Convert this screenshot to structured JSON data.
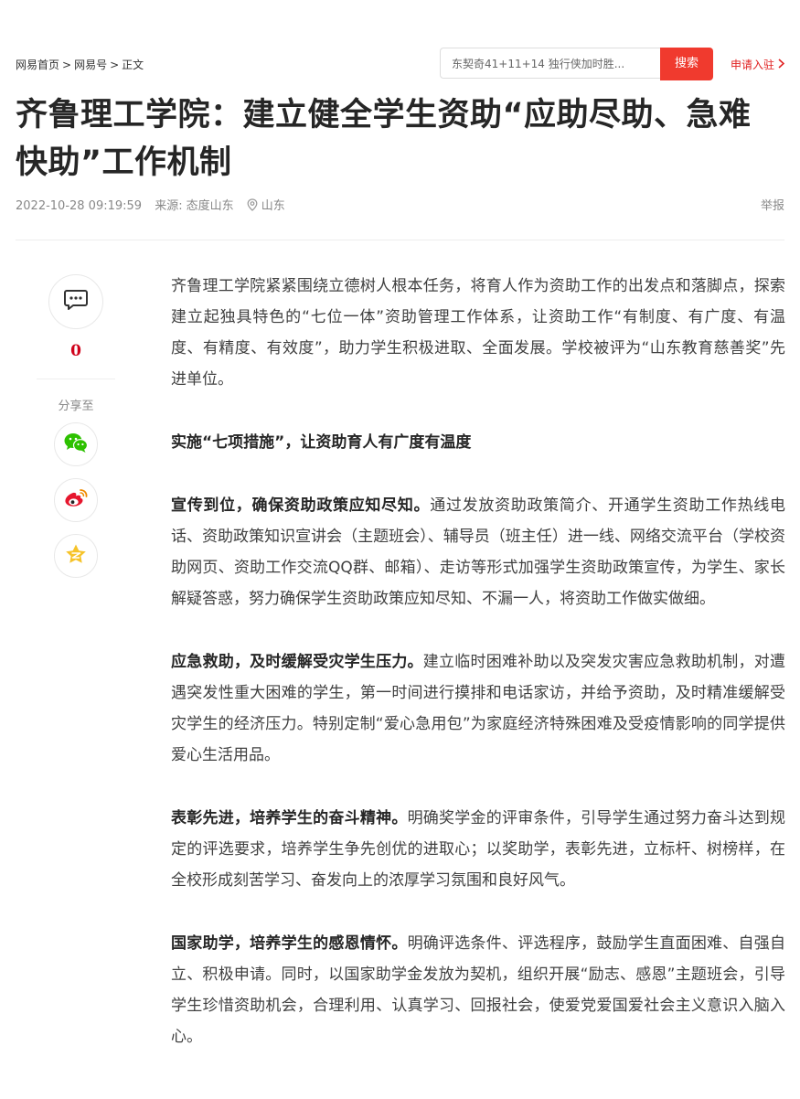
{
  "breadcrumb": {
    "home": "网易首页",
    "sep1": ">",
    "section": "网易号",
    "sep2": ">",
    "current": "正文"
  },
  "search": {
    "value": "东契奇41+11+14 独行侠加时胜...",
    "button": "搜索"
  },
  "apply": {
    "label": "申请入驻"
  },
  "article": {
    "title": "齐鲁理工学院：建立健全学生资助“应助尽助、急难快助”工作机制",
    "date": "2022-10-28 09:19:59",
    "source_prefix": "来源:",
    "source": "态度山东",
    "location": "山东",
    "report": "举报"
  },
  "sidebar": {
    "comment_count": "0",
    "share_label": "分享至"
  },
  "icons": {
    "comment": "comment-bubble-icon",
    "wechat": "wechat-icon",
    "weibo": "weibo-icon",
    "qzone": "qzone-star-icon",
    "location": "location-pin-icon",
    "chevron": "chevron-right-icon"
  },
  "colors": {
    "brand_red": "#f03a2e",
    "accent_red": "#e02020",
    "wechat_green": "#2dc100",
    "qzone_yellow": "#f6c32a"
  },
  "content": {
    "intro": "齐鲁理工学院紧紧围绕立德树人根本任务，将育人作为资助工作的出发点和落脚点，探索建立起独具特色的“七位一体”资助管理工作体系，让资助工作“有制度、有广度、有温度、有精度、有效度”，助力学生积极进取、全面发展。学校被评为“山东教育慈善奖”先进单位。",
    "heading": "实施“七项措施”，让资助育人有广度有温度",
    "p1_bold": "宣传到位，确保资助政策应知尽知。",
    "p1_text": "通过发放资助政策简介、开通学生资助工作热线电话、资助政策知识宣讲会（主题班会）、辅导员（班主任）进一线、网络交流平台（学校资助网页、资助工作交流QQ群、邮箱）、走访等形式加强学生资助政策宣传，为学生、家长解疑答惑，努力确保学生资助政策应知尽知、不漏一人，将资助工作做实做细。",
    "p2_bold": "应急救助，及时缓解受灾学生压力。",
    "p2_text": "建立临时困难补助以及突发灾害应急救助机制，对遭遇突发性重大困难的学生，第一时间进行摸排和电话家访，并给予资助，及时精准缓解受灾学生的经济压力。特别定制“爱心急用包”为家庭经济特殊困难及受疫情影响的同学提供爱心生活用品。",
    "p3_bold": "表彰先进，培养学生的奋斗精神。",
    "p3_text": "明确奖学金的评审条件，引导学生通过努力奋斗达到规定的评选要求，培养学生争先创优的进取心；以奖助学，表彰先进，立标杆、树榜样，在全校形成刻苦学习、奋发向上的浓厚学习氛围和良好风气。",
    "p4_bold": "国家助学，培养学生的感恩情怀。",
    "p4_text": "明确评选条件、评选程序，鼓励学生直面困难、自强自立、积极申请。同时，以国家助学金发放为契机，组织开展“励志、感恩”主题班会，引导学生珍惜资助机会，合理利用、认真学习、回报社会，使爱党爱国爱社会主义意识入脑入心。"
  }
}
